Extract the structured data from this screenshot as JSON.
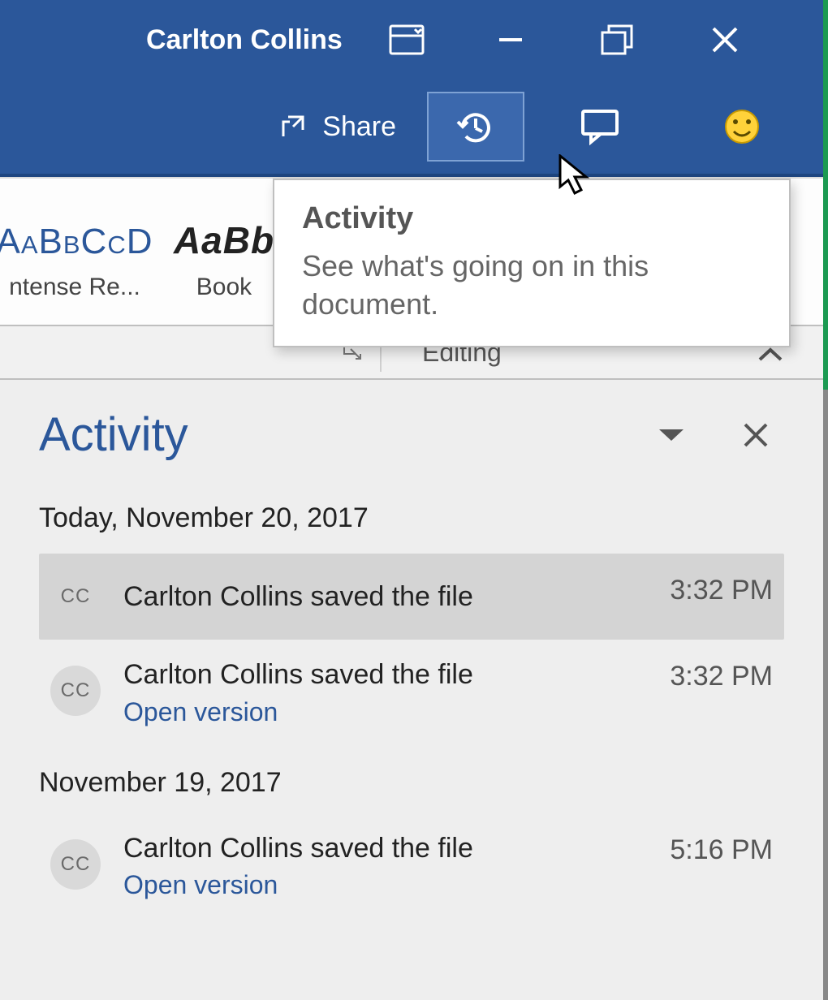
{
  "window": {
    "user_name": "Carlton Collins"
  },
  "toolbar": {
    "share_label": "Share"
  },
  "tooltip": {
    "title": "Activity",
    "body": "See what's going on in this document."
  },
  "styles_gallery": [
    {
      "sample": "AaBbCcD",
      "caption": "ntense Re..."
    },
    {
      "sample": "AaBb",
      "caption": "Book "
    }
  ],
  "groupbar": {
    "editing_label": "Editing"
  },
  "pane": {
    "title": "Activity",
    "groups": [
      {
        "date": "Today, November 20, 2017",
        "entries": [
          {
            "initials": "CC",
            "text": "Carlton Collins saved the file",
            "time": "3:32 PM",
            "open_version": false,
            "selected": true
          },
          {
            "initials": "CC",
            "text": "Carlton Collins saved the file",
            "time": "3:32 PM",
            "open_version": true,
            "selected": false
          }
        ]
      },
      {
        "date": "November 19, 2017",
        "entries": [
          {
            "initials": "CC",
            "text": "Carlton Collins saved the file",
            "time": "5:16 PM",
            "open_version": true,
            "selected": false
          }
        ]
      }
    ],
    "open_version_label": "Open version"
  }
}
